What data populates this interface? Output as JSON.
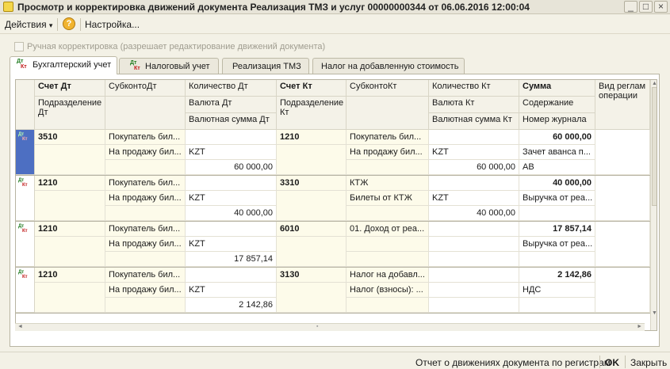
{
  "window": {
    "title": "Просмотр и корректировка движений документа Реализация ТМЗ и услуг 00000000344 от 06.06.2016 12:00:04",
    "minimize": "_",
    "maximize": "□",
    "close": "×"
  },
  "toolbar": {
    "actions_label": "Действия",
    "actions_arrow": "▾",
    "help_label": "?",
    "settings_label": "Настройка..."
  },
  "manual_correction": {
    "label": "Ручная корректировка (разрешает редактирование движений документа)",
    "checked": false
  },
  "tabs": [
    {
      "label": "Бухгалтерский учет",
      "active": true,
      "icon_top": "Дт",
      "icon_bottom": "Кт"
    },
    {
      "label": "Налоговый учет",
      "active": false,
      "icon_top": "Дт",
      "icon_bottom": "Кт"
    },
    {
      "label": "Реализация ТМЗ",
      "active": false
    },
    {
      "label": "Налог на добавленную стоимость",
      "active": false
    }
  ],
  "grid": {
    "headers": {
      "row1": [
        "Счет Дт",
        "СубконтоДт",
        "Количество Дт",
        "Счет Кт",
        "СубконтоКт",
        "Количество Кт",
        "Сумма",
        "Вид реглам операции"
      ],
      "row2": [
        "Подразделение Дт",
        "",
        "Валюта Дт",
        "Подразделение Кт",
        "",
        "Валюта Кт",
        "Содержание",
        ""
      ],
      "row3": [
        "",
        "",
        "Валютная сумма Дт",
        "",
        "",
        "Валютная сумма Кт",
        "Номер журнала",
        ""
      ]
    },
    "rows": [
      {
        "marker_top": "Дт",
        "marker_bottom": "Кт",
        "selected": true,
        "account_dt": "3510",
        "subconto_dt_1": "Покупатель бил...",
        "subconto_dt_2": "На продажу бил...",
        "qty_dt": "",
        "currency_dt": "KZT",
        "cur_sum_dt": "60 000,00",
        "account_kt": "1210",
        "subconto_kt_1": "Покупатель бил...",
        "subconto_kt_2": "На продажу бил...",
        "qty_kt": "",
        "currency_kt": "KZT",
        "cur_sum_kt": "60 000,00",
        "sum": "60 000,00",
        "content": "Зачет аванса п...",
        "journal": "АВ"
      },
      {
        "marker_top": "Дт",
        "marker_bottom": "Кт",
        "selected": false,
        "account_dt": "1210",
        "subconto_dt_1": "Покупатель бил...",
        "subconto_dt_2": "На продажу бил...",
        "qty_dt": "",
        "currency_dt": "KZT",
        "cur_sum_dt": "40 000,00",
        "account_kt": "3310",
        "subconto_kt_1": "КТЖ",
        "subconto_kt_2": "Билеты от КТЖ",
        "qty_kt": "",
        "currency_kt": "KZT",
        "cur_sum_kt": "40 000,00",
        "sum": "40 000,00",
        "content": "Выручка от реа...",
        "journal": ""
      },
      {
        "marker_top": "Дт",
        "marker_bottom": "Кт",
        "selected": false,
        "account_dt": "1210",
        "subconto_dt_1": "Покупатель бил...",
        "subconto_dt_2": "На продажу бил...",
        "qty_dt": "",
        "currency_dt": "KZT",
        "cur_sum_dt": "17 857,14",
        "account_kt": "6010",
        "subconto_kt_1": "01. Доход от реа...",
        "subconto_kt_2": "",
        "qty_kt": "",
        "currency_kt": "",
        "cur_sum_kt": "",
        "sum": "17 857,14",
        "content": "Выручка от реа...",
        "journal": ""
      },
      {
        "marker_top": "Дт",
        "marker_bottom": "Кт",
        "selected": false,
        "account_dt": "1210",
        "subconto_dt_1": "Покупатель бил...",
        "subconto_dt_2": "На продажу бил...",
        "qty_dt": "",
        "currency_dt": "KZT",
        "cur_sum_dt": "2 142,86",
        "account_kt": "3130",
        "subconto_kt_1": "Налог на добавл...",
        "subconto_kt_2": "Налог (взносы): ...",
        "qty_kt": "",
        "currency_kt": "",
        "cur_sum_kt": "",
        "sum": "2 142,86",
        "content": "НДС",
        "journal": ""
      }
    ]
  },
  "scroll_glyphs": {
    "up": "▲",
    "down": "▼",
    "left": "◄",
    "right": "►",
    "dot": "▪"
  },
  "statusbar": {
    "report_label": "Отчет о движениях документа по регистрам",
    "ok_label": "OK",
    "close_label": "Закрыть"
  }
}
